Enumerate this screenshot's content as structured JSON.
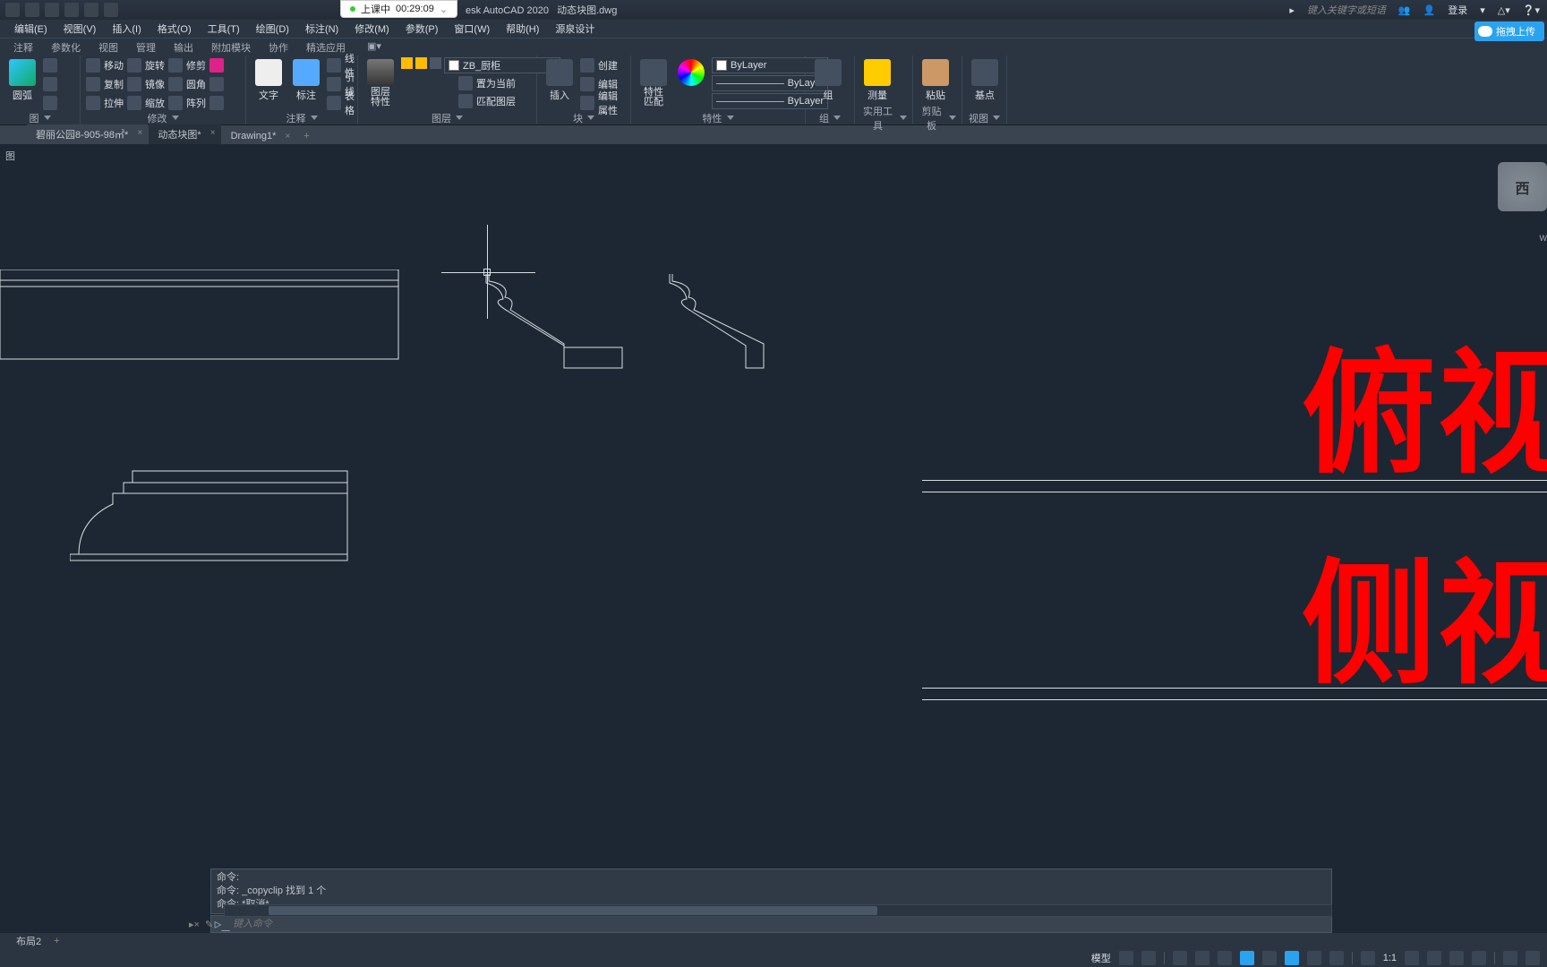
{
  "title": {
    "app": "esk AutoCAD 2020",
    "doc": "动态块图.dwg",
    "login": "登录",
    "search_ph": "键入关键字或短语"
  },
  "lesson": {
    "status": "上课中",
    "time": "00:29:09"
  },
  "baidu_btn": "拖拽上传",
  "menu": [
    "编辑(E)",
    "视图(V)",
    "插入(I)",
    "格式(O)",
    "工具(T)",
    "绘图(D)",
    "标注(N)",
    "修改(M)",
    "参数(P)",
    "窗口(W)",
    "帮助(H)",
    "源泉设计"
  ],
  "ribtabs": [
    "注释",
    "参数化",
    "视图",
    "管理",
    "输出",
    "附加模块",
    "协作",
    "精选应用"
  ],
  "ribbon": {
    "draw": {
      "arc": "圆弧",
      "label": "图"
    },
    "modify": {
      "move": "移动",
      "rotate": "旋转",
      "trim": "修剪",
      "copy": "复制",
      "mirror": "镜像",
      "fillet": "圆角",
      "stretch": "拉伸",
      "scale": "缩放",
      "array": "阵列",
      "label": "修改"
    },
    "annot": {
      "text": "文字",
      "dim": "标注",
      "line": "线性",
      "leader": "引线",
      "table": "表格",
      "label": "注释"
    },
    "layer": {
      "props": "图层\n特性",
      "current": "ZB_厨柜",
      "setcur": "置为当前",
      "match": "匹配图层",
      "label": "图层"
    },
    "block": {
      "insert": "插入",
      "create": "创建",
      "edit": "编辑",
      "editattr": "编辑属性",
      "label": "块"
    },
    "props": {
      "props": "特性\n匹配",
      "bylayer": "ByLayer",
      "label": "特性"
    },
    "group": {
      "g": "组",
      "label": "组"
    },
    "util": {
      "measure": "测量",
      "label": "实用工具"
    },
    "clip": {
      "paste": "粘贴",
      "label": "剪贴板"
    },
    "view": {
      "base": "基点",
      "label": "视图"
    }
  },
  "filetabs": [
    {
      "name": "碧丽公园8-905-98㎡*"
    },
    {
      "name": "动态块图*"
    },
    {
      "name": "Drawing1*"
    }
  ],
  "view_label": "图",
  "viewcube": "西",
  "wcs": "W",
  "redtext": {
    "top": "俯视",
    "bottom": "侧视"
  },
  "cmd": {
    "hist1": "命令:",
    "hist2": "命令: _copyclip 找到 1 个",
    "hist3": "命令: *取消*",
    "placeholder": "键入命令"
  },
  "layouts": {
    "tab": "布局2"
  },
  "status": {
    "model": "模型",
    "scale": "1:1"
  }
}
